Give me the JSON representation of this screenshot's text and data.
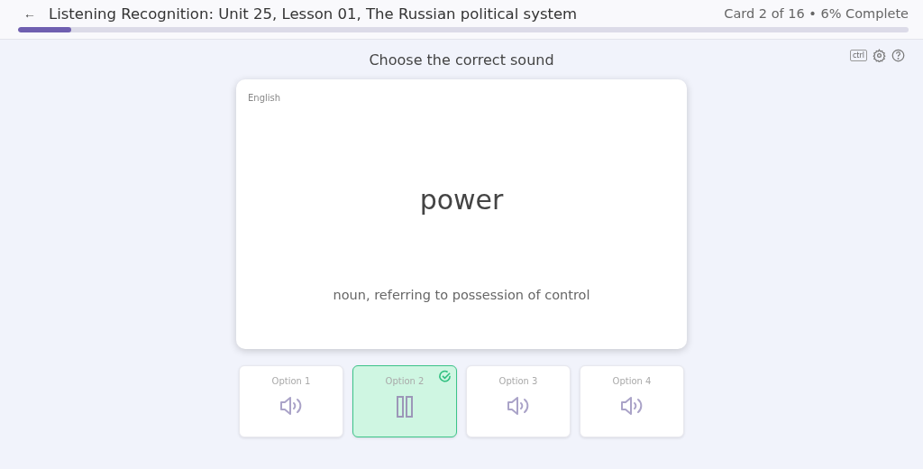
{
  "header": {
    "back": "←",
    "title": "Listening Recognition: Unit 25, Lesson 01, The Russian political system",
    "status": "Card 2 of 16 • 6% Complete",
    "progress": {
      "level": 0.06
    }
  },
  "toolbar": {
    "key_hint": "ctrl"
  },
  "prompt": "Choose the correct sound",
  "card": {
    "language": "English",
    "word": "power",
    "definition": "noun, referring to possession of control"
  },
  "options": [
    {
      "label": "Option 1",
      "selected": false
    },
    {
      "label": "Option 2",
      "selected": true
    },
    {
      "label": "Option 3",
      "selected": false
    },
    {
      "label": "Option 4",
      "selected": false
    }
  ]
}
